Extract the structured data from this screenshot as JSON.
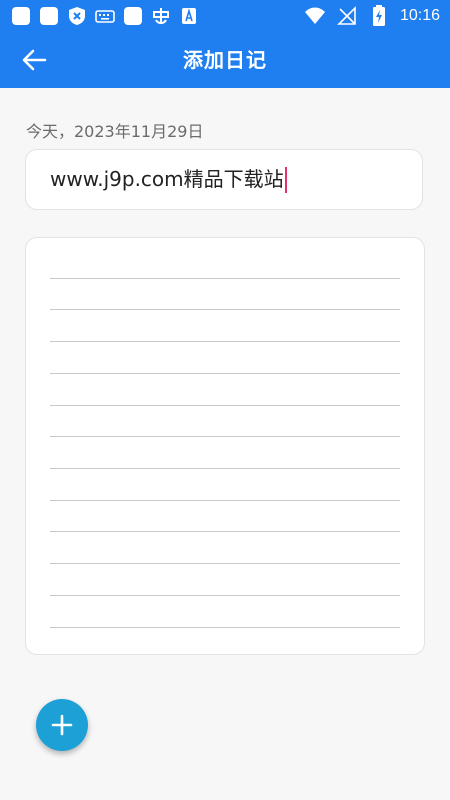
{
  "status_bar": {
    "time": "10:16",
    "left_icons": [
      "app-icon",
      "app-icon",
      "shield-icon",
      "keyboard-icon",
      "app-icon",
      "bug-icon",
      "font-icon"
    ],
    "right_icons": [
      "wifi-icon",
      "no-signal-icon",
      "battery-charging-icon"
    ]
  },
  "app_bar": {
    "title": "添加日记",
    "back_icon": "arrow-left-icon",
    "background": "#1f7ef0"
  },
  "entry": {
    "date": "今天，2023年11月29日",
    "title_value": "www.j9p.com精品下载站",
    "body_value": ""
  },
  "fab": {
    "icon": "plus-icon",
    "color": "#1da0d6"
  }
}
